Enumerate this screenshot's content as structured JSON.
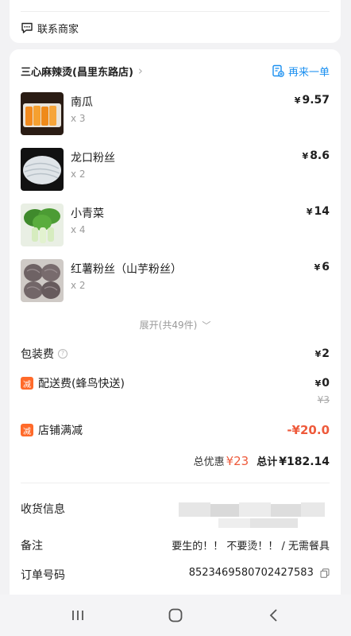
{
  "contact": {
    "label": "联系商家",
    "icon": "chat-bubble-icon"
  },
  "shop": {
    "name": "三心麻辣烫(昌里东路店)",
    "reorder_label": "再来一单",
    "accent": "#1a8ff0"
  },
  "items": [
    {
      "name": "南瓜",
      "qty": "x 3",
      "price": "9.57",
      "currency": "¥"
    },
    {
      "name": "龙口粉丝",
      "qty": "x 2",
      "price": "8.6",
      "currency": "¥"
    },
    {
      "name": "小青菜",
      "qty": "x 4",
      "price": "14",
      "currency": "¥"
    },
    {
      "name": "红薯粉丝（山芋粉丝）",
      "qty": "x 2",
      "price": "6",
      "currency": "¥"
    }
  ],
  "expand_label": "展开(共49件)",
  "fees": {
    "packaging": {
      "label": "包装费",
      "amount": "2",
      "currency": "¥"
    },
    "delivery": {
      "badge": "减",
      "label": "配送费(蜂鸟快送)",
      "amount": "0",
      "currency": "¥",
      "original": "¥3"
    },
    "shop_discount": {
      "badge": "减",
      "label": "店铺满减",
      "amount": "-¥20.0"
    }
  },
  "totals": {
    "discount_label": "总优惠",
    "discount_value": "¥23",
    "total_label": "总计",
    "total_value": "¥182.14"
  },
  "info": {
    "address_label": "收货信息",
    "note_label": "备注",
    "note_value": "要生的！！ 不要烫！！ / 无需餐具",
    "order_label": "订单号码",
    "order_value": "8523469580702427583"
  },
  "colors": {
    "discount_red": "#ee5a3b",
    "badge_orange": "#ff6a2a"
  }
}
